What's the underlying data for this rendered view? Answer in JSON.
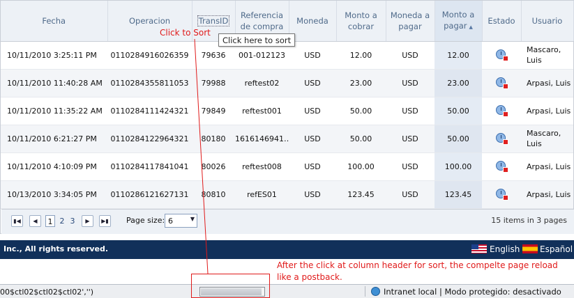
{
  "grid": {
    "columns": [
      "Fecha",
      "Operacion",
      "TransID",
      "Referencia de compra",
      "Moneda",
      "Monto a cobrar",
      "Moneda a pagar",
      "Monto a pagar",
      "Estado",
      "Usuario"
    ],
    "rows": [
      {
        "fecha": "10/11/2010 3:25:11 PM",
        "operacion": "0110284916026359",
        "transid": "79636",
        "referencia": "001-012123",
        "moneda": "USD",
        "cobrar": "12.00",
        "moneda_pagar": "USD",
        "pagar": "12.00",
        "estado": "pending-stop-icon",
        "usuario": "Mascaro, Luis"
      },
      {
        "fecha": "10/11/2010 11:40:28 AM",
        "operacion": "0110284355811053",
        "transid": "79988",
        "referencia": "reftest02",
        "moneda": "USD",
        "cobrar": "23.00",
        "moneda_pagar": "USD",
        "pagar": "23.00",
        "estado": "pending-stop-icon",
        "usuario": "Arpasi, Luis"
      },
      {
        "fecha": "10/11/2010 11:35:22 AM",
        "operacion": "0110284111424321",
        "transid": "79849",
        "referencia": "reftest001",
        "moneda": "USD",
        "cobrar": "50.00",
        "moneda_pagar": "USD",
        "pagar": "50.00",
        "estado": "pending-stop-icon",
        "usuario": "Arpasi, Luis"
      },
      {
        "fecha": "10/11/2010 6:21:27 PM",
        "operacion": "0110284122964321",
        "transid": "80180",
        "referencia": "1616146941…",
        "moneda": "USD",
        "cobrar": "50.00",
        "moneda_pagar": "USD",
        "pagar": "50.00",
        "estado": "pending-stop-icon",
        "usuario": "Mascaro, Luis"
      },
      {
        "fecha": "10/11/2010 4:10:09 PM",
        "operacion": "0110284117841041",
        "transid": "80026",
        "referencia": "reftest008",
        "moneda": "USD",
        "cobrar": "100.00",
        "moneda_pagar": "USD",
        "pagar": "100.00",
        "estado": "pending-stop-icon",
        "usuario": "Arpasi, Luis"
      },
      {
        "fecha": "10/13/2010 3:34:05 PM",
        "operacion": "0110286121627131",
        "transid": "80810",
        "referencia": "refES01",
        "moneda": "USD",
        "cobrar": "123.45",
        "moneda_pagar": "USD",
        "pagar": "123.45",
        "estado": "pending-stop-icon",
        "usuario": "Arpasi, Luis"
      }
    ]
  },
  "pager": {
    "first": "⏮",
    "prev": "◀",
    "next": "▶",
    "last": "⏭",
    "pages": [
      "1",
      "2",
      "3"
    ],
    "page_size_label": "Page size:",
    "page_size_value": "6",
    "info": "15 items in 3 pages"
  },
  "footer": {
    "copyright": "Inc., All rights reserved.",
    "english": "English",
    "spanish": "Español"
  },
  "statusbar": {
    "script": "00$ctl02$ctl02$ctl02','')",
    "zone": "Intranet local | Modo protegido: desactivado",
    "progress": 0.97
  },
  "annotations": {
    "click_to_sort": "Click to Sort",
    "tooltip": "Click here to sort",
    "after_click_line1": "After the click at column header for sort, the compelte page reload",
    "after_click_line2": "like a postback."
  },
  "colors": {
    "header_bg": "#edf1f6",
    "footer_bg": "#11305a",
    "annotation_red": "#e01a1a"
  }
}
